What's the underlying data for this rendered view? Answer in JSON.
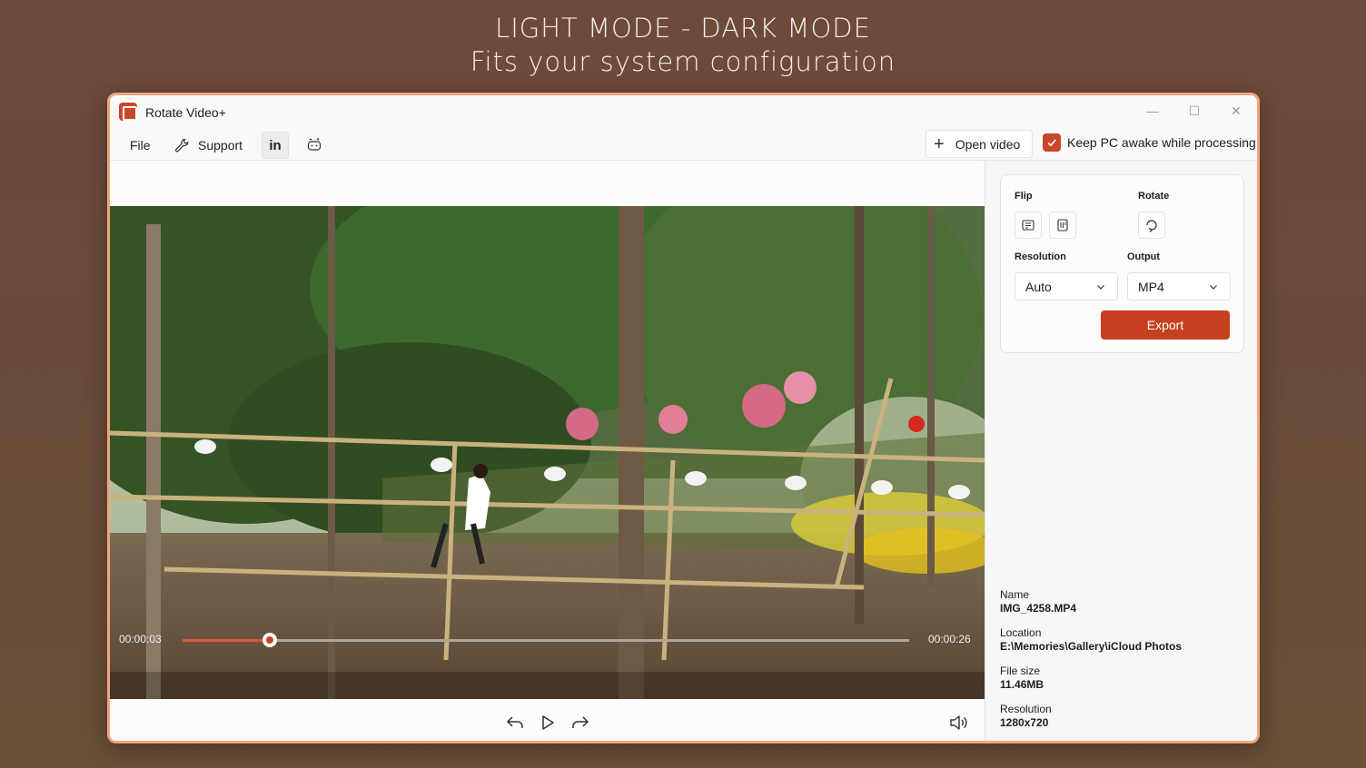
{
  "promo": {
    "line1": "LIGHT MODE - DARK MODE",
    "line2": "Fits your system configuration"
  },
  "window": {
    "title": "Rotate Video+",
    "accent": "#c8462a"
  },
  "menu": {
    "file": "File",
    "support": "Support",
    "linkedin": "in",
    "open_video": "Open video",
    "keep_awake_label": "Keep PC awake while processing",
    "keep_awake_checked": true
  },
  "player": {
    "current_time": "00:00:03",
    "total_time": "00:00:26",
    "progress": 0.12
  },
  "panel": {
    "flip_label": "Flip",
    "rotate_label": "Rotate",
    "resolution_label": "Resolution",
    "output_label": "Output",
    "resolution_value": "Auto",
    "output_value": "MP4",
    "export_label": "Export"
  },
  "file_info": {
    "name_label": "Name",
    "name_value": "IMG_4258.MP4",
    "location_label": "Location",
    "location_value": "E:\\Memories\\Gallery\\iCloud Photos",
    "size_label": "File size",
    "size_value": "11.46MB",
    "resolution_label": "Resolution",
    "resolution_value": "1280x720"
  }
}
